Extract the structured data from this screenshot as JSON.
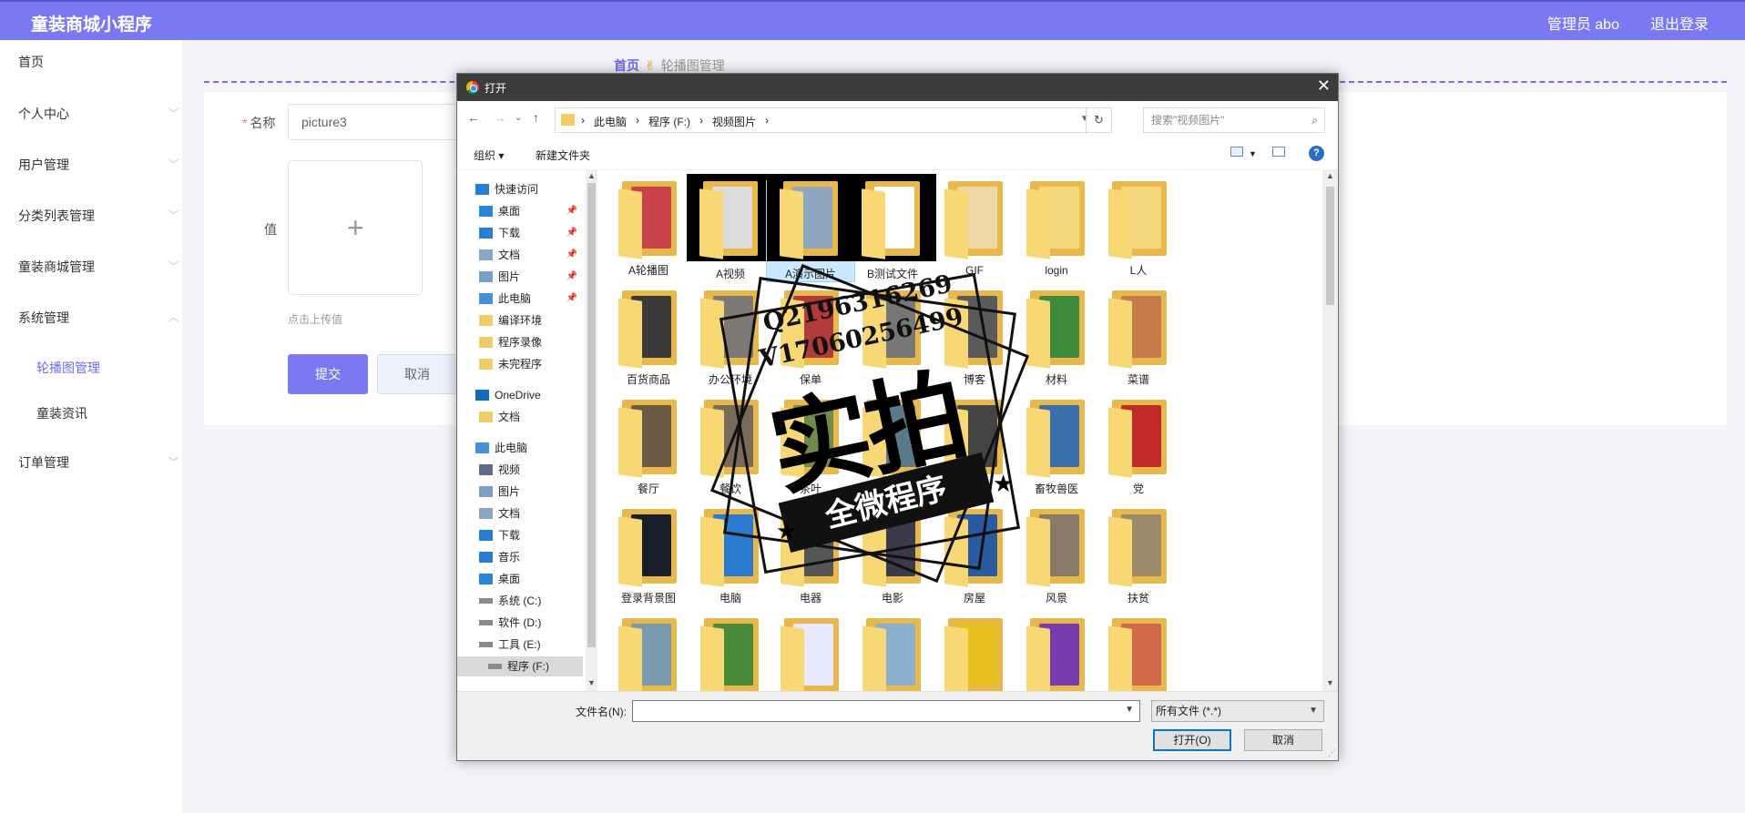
{
  "header": {
    "brand": "童装商城小程序",
    "user": "管理员 abo",
    "logout": "退出登录"
  },
  "sidebar": {
    "items": [
      {
        "label": "首页",
        "chevron": ""
      },
      {
        "label": "个人中心",
        "chevron": "﹀"
      },
      {
        "label": "用户管理",
        "chevron": "﹀"
      },
      {
        "label": "分类列表管理",
        "chevron": "﹀"
      },
      {
        "label": "童装商城管理",
        "chevron": "﹀"
      },
      {
        "label": "系统管理",
        "chevron": "︿"
      },
      {
        "label": "订单管理",
        "chevron": "﹀"
      }
    ],
    "subitems": [
      {
        "label": "轮播图管理",
        "active": true
      },
      {
        "label": "童装资讯",
        "active": false
      }
    ]
  },
  "breadcrumb": {
    "home": "首页",
    "current": "轮播图管理"
  },
  "form": {
    "name_label": "名称",
    "name_value": "picture3",
    "value_label": "值",
    "upload_hint": "点击上传值",
    "submit": "提交",
    "cancel": "取消"
  },
  "dialog": {
    "title": "打开",
    "close": "✕",
    "path": [
      "此电脑",
      "程序 (F:)",
      "视频图片"
    ],
    "search_placeholder": "搜索\"视频图片\"",
    "organize": "组织 ▾",
    "new_folder": "新建文件夹",
    "help": "?",
    "nav": [
      {
        "label": "快速访问",
        "icon": "star-icon",
        "kind": "top"
      },
      {
        "label": "桌面",
        "icon": "desktop-icon",
        "pinned": true
      },
      {
        "label": "下载",
        "icon": "download-icon",
        "pinned": true
      },
      {
        "label": "文档",
        "icon": "document-icon",
        "pinned": true
      },
      {
        "label": "图片",
        "icon": "picture-icon",
        "pinned": true
      },
      {
        "label": "此电脑",
        "icon": "computer-icon",
        "pinned": true
      },
      {
        "label": "编译环境",
        "icon": "folder-icon"
      },
      {
        "label": "程序录像",
        "icon": "folder-icon"
      },
      {
        "label": "未完程序",
        "icon": "folder-icon"
      },
      {
        "label": "OneDrive",
        "icon": "cloud-icon",
        "kind": "top"
      },
      {
        "label": "文档",
        "icon": "folder-icon"
      },
      {
        "label": "此电脑",
        "icon": "computer-icon",
        "kind": "top"
      },
      {
        "label": "视频",
        "icon": "video-icon"
      },
      {
        "label": "图片",
        "icon": "picture-icon"
      },
      {
        "label": "文档",
        "icon": "document-icon"
      },
      {
        "label": "下载",
        "icon": "download-icon"
      },
      {
        "label": "音乐",
        "icon": "music-icon"
      },
      {
        "label": "桌面",
        "icon": "desktop-icon"
      },
      {
        "label": "系统 (C:)",
        "icon": "drive-icon"
      },
      {
        "label": "软件 (D:)",
        "icon": "drive-icon"
      },
      {
        "label": "工具 (E:)",
        "icon": "drive-icon"
      },
      {
        "label": "程序 (F:)",
        "icon": "drive-icon",
        "selected": true
      }
    ],
    "files": [
      {
        "name": "A轮播图",
        "color": "#c9414b"
      },
      {
        "name": "A视频",
        "color": "#dcdcdc",
        "black": true
      },
      {
        "name": "A演示图片",
        "color": "#8fa6c0",
        "black": true,
        "selected": true
      },
      {
        "name": "B测试文件",
        "color": "#ffffff",
        "black": true
      },
      {
        "name": "GIF",
        "color": "#f0d7a6"
      },
      {
        "name": "login",
        "color": "#f5d77e"
      },
      {
        "name": "L人",
        "color": "#f5d77e"
      },
      {
        "name": "百货商品",
        "color": "#3a3a3a"
      },
      {
        "name": "办公环境",
        "color": "#7d7a75"
      },
      {
        "name": "保单",
        "color": "#b33a3a"
      },
      {
        "name": "",
        "color": "#777777"
      },
      {
        "name": "博客",
        "color": "#5a5a5a"
      },
      {
        "name": "材料",
        "color": "#3d8a3d"
      },
      {
        "name": "菜谱",
        "color": "#c77a4a"
      },
      {
        "name": "餐厅",
        "color": "#6b5a44"
      },
      {
        "name": "餐饮",
        "color": "#7a6a5a"
      },
      {
        "name": "茶叶",
        "color": "#6f8a4a"
      },
      {
        "name": "",
        "color": "#5a7a8a"
      },
      {
        "name": "宠物",
        "color": "#444444"
      },
      {
        "name": "畜牧兽医",
        "color": "#3a6fae"
      },
      {
        "name": "党",
        "color": "#c22a2a"
      },
      {
        "name": "登录背景图",
        "color": "#1a1d2a"
      },
      {
        "name": "电脑",
        "color": "#2a7ad0"
      },
      {
        "name": "电器",
        "color": "#555555"
      },
      {
        "name": "电影",
        "color": "#3a3a4a"
      },
      {
        "name": "房屋",
        "color": "#2a5aa0"
      },
      {
        "name": "风景",
        "color": "#8a7a6a"
      },
      {
        "name": "扶贫",
        "color": "#9a8a6a"
      },
      {
        "name": "",
        "color": "#7a9ab0"
      },
      {
        "name": "",
        "color": "#4a8a3a"
      },
      {
        "name": "",
        "color": "#e8e8ff"
      },
      {
        "name": "",
        "color": "#8ab0d0"
      },
      {
        "name": "",
        "color": "#e8c020"
      },
      {
        "name": "",
        "color": "#7a3ab0"
      },
      {
        "name": "",
        "color": "#d06a4a"
      }
    ],
    "filename_label": "文件名(N):",
    "filename_value": "",
    "filetype": "所有文件 (*.*)",
    "open": "打开(O)",
    "cancel": "取消"
  },
  "watermark": {
    "qq": "Q2196316269",
    "v": "V17060256499",
    "big": "实拍",
    "ribbon": "全微程序"
  }
}
